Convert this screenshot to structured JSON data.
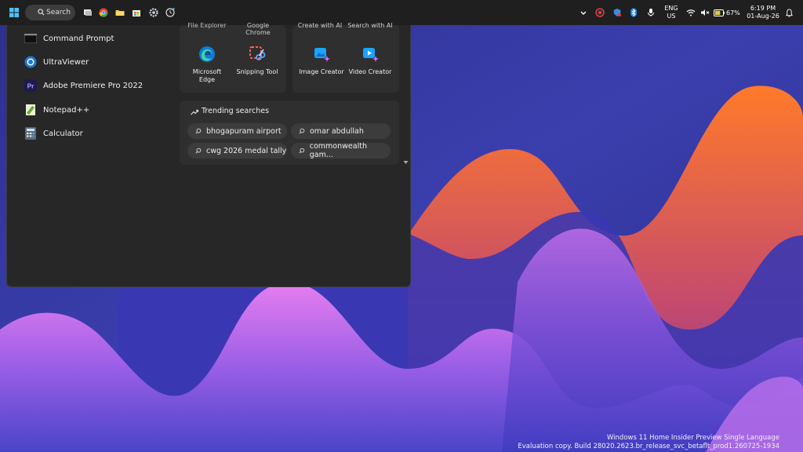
{
  "taskbar": {
    "search_label": "Search",
    "tray": {
      "language_line1": "ENG",
      "language_line2": "US",
      "battery_percent": "67%",
      "time": "6:19 PM",
      "date": "01-Aug-26"
    }
  },
  "apps": [
    {
      "label": "Command Prompt",
      "icon": "command-prompt-icon"
    },
    {
      "label": "UltraViewer",
      "icon": "ultraviewer-icon"
    },
    {
      "label": "Adobe Premiere Pro 2022",
      "icon": "premiere-pro-icon"
    },
    {
      "label": "Notepad++",
      "icon": "notepadpp-icon"
    },
    {
      "label": "Calculator",
      "icon": "calculator-icon"
    }
  ],
  "top_apps_cut": [
    "File Explorer",
    "Google",
    "Chrome"
  ],
  "top_apps": [
    {
      "line1": "Microsoft",
      "line2": "Edge",
      "icon": "edge-icon"
    },
    {
      "line1": "Snipping Tool",
      "line2": "",
      "icon": "snipping-tool-icon"
    }
  ],
  "create_cut": [
    "Create with AI",
    "Search with AI"
  ],
  "create_tiles": [
    {
      "label": "Image Creator",
      "icon": "image-creator-icon"
    },
    {
      "label": "Video Creator",
      "icon": "video-creator-icon"
    }
  ],
  "trending": {
    "title": "Trending searches",
    "items": [
      "bhogapuram airport",
      "omar abdullah",
      "cwg 2026 medal tally",
      "commonwealth gam..."
    ]
  },
  "watermark": {
    "line1": "Windows 11 Home Insider Preview Single Language",
    "line2": "Evaluation copy. Build 28020.2623.br_release_svc_betaflt_prod1.260725-1934"
  },
  "colors": {
    "taskbar": "#1f1f1f",
    "panel": "#272727",
    "card": "#2f2f2f",
    "chip": "#3c3c3c",
    "accent": "#3b82f6"
  }
}
